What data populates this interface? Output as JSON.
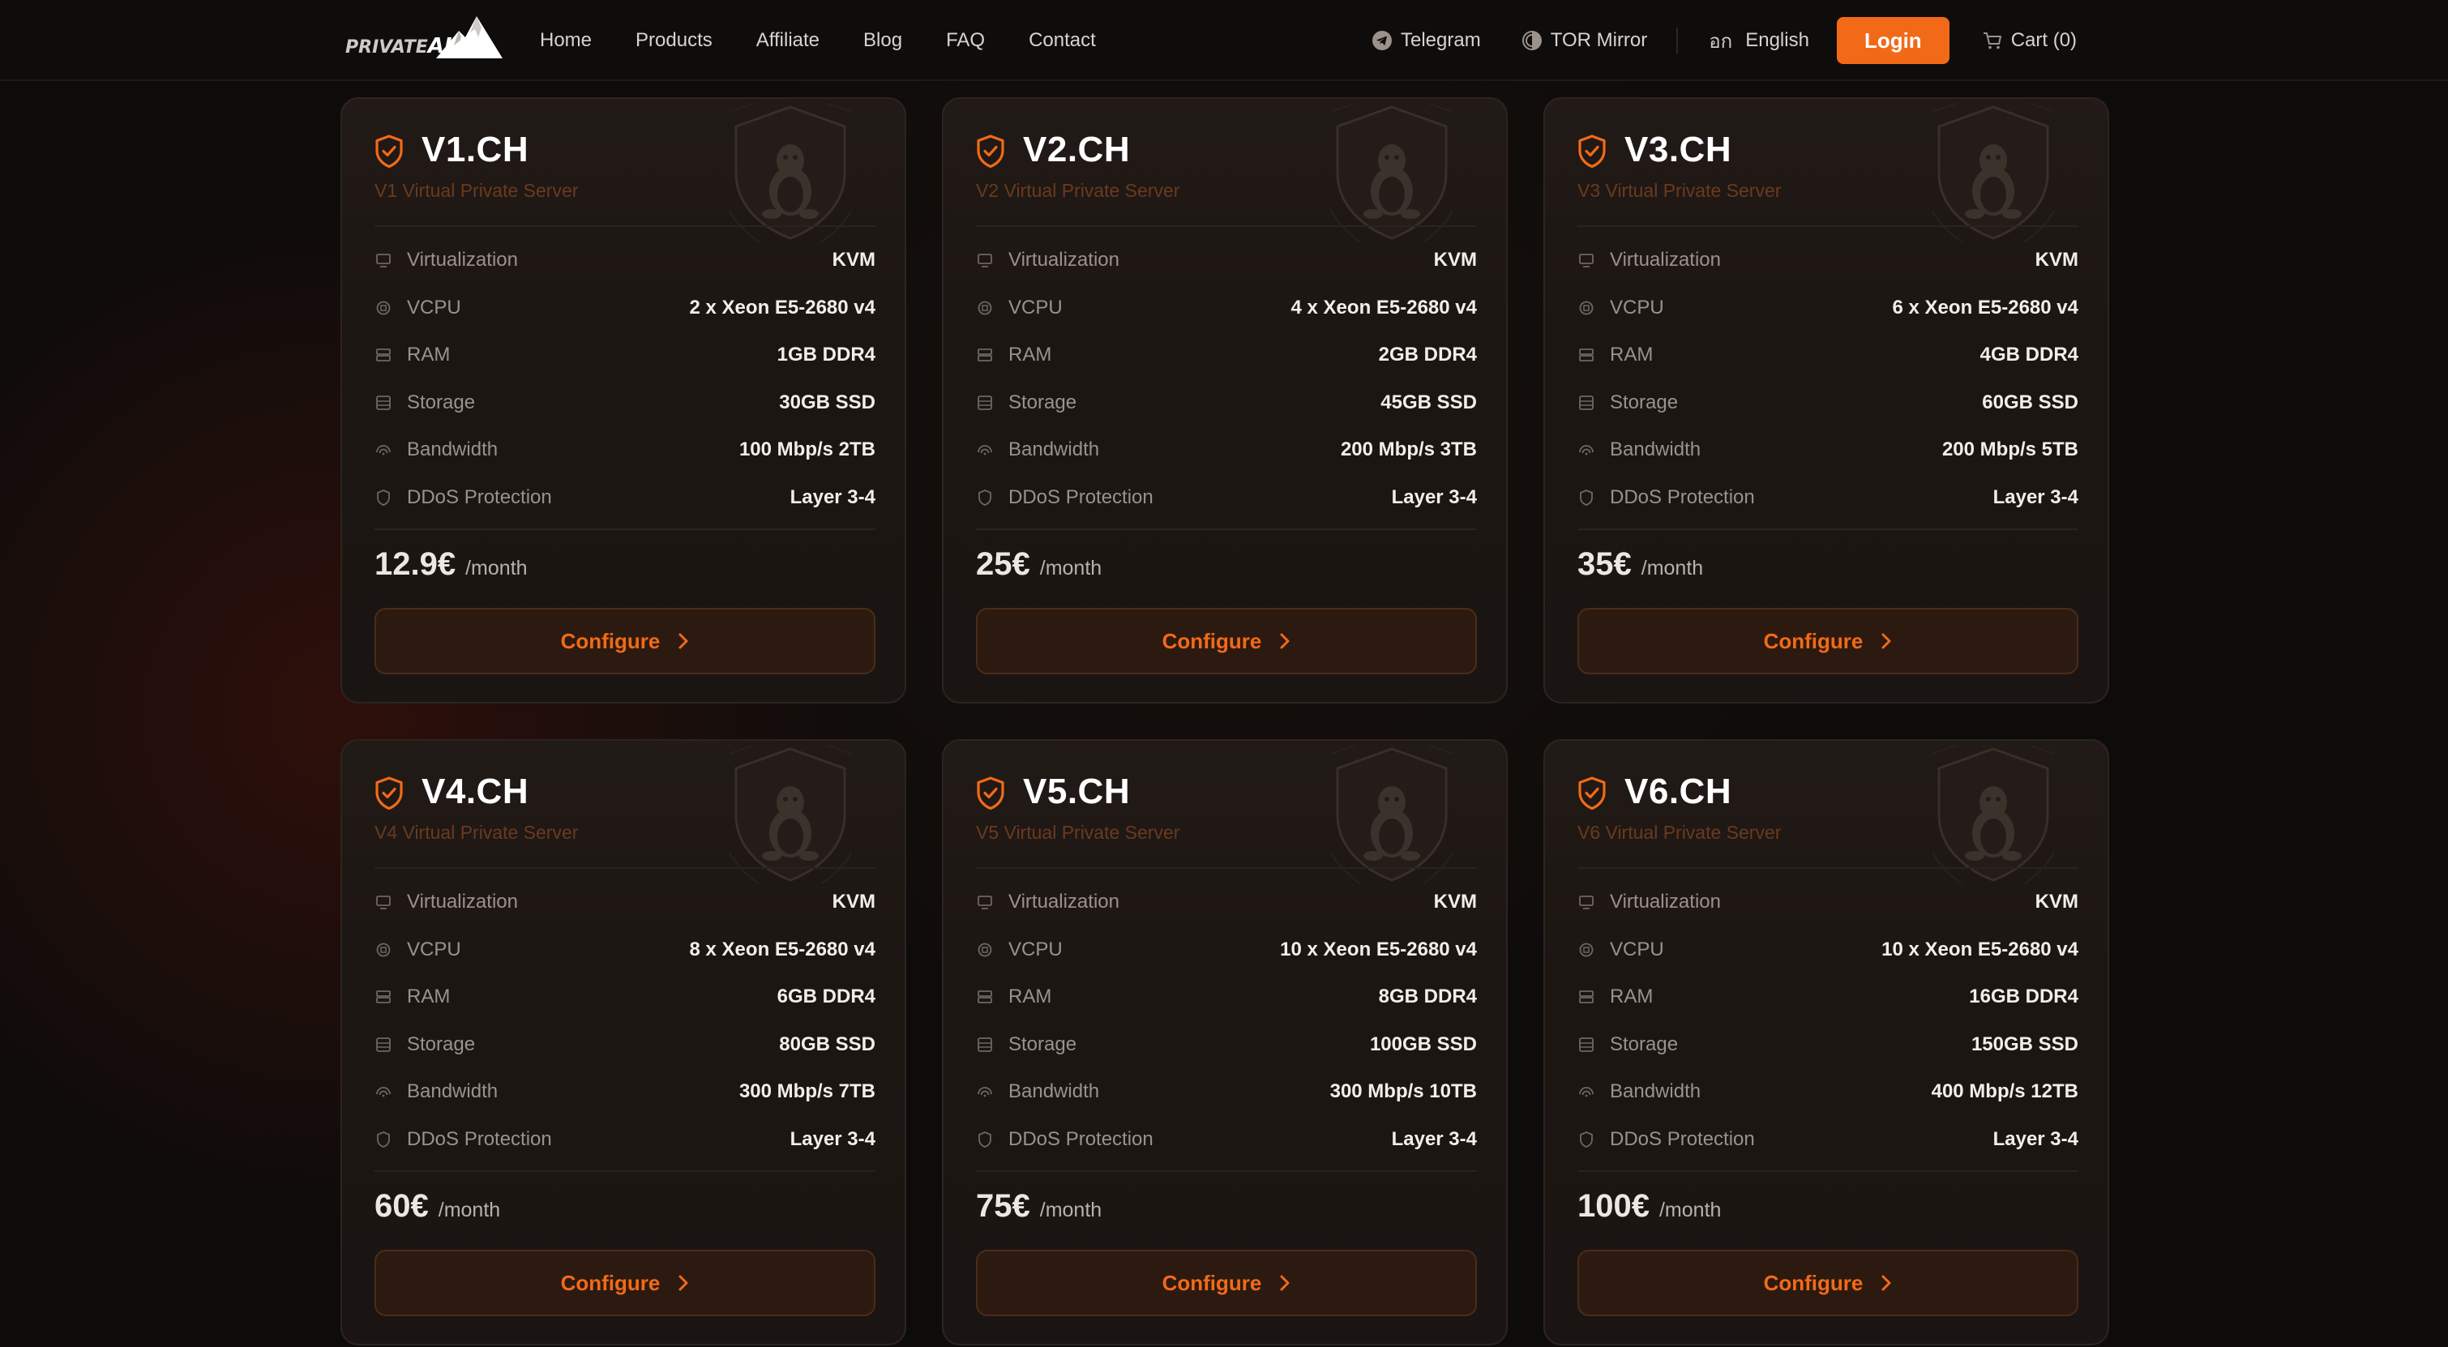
{
  "brand": {
    "logo_left": "PRIVATE",
    "logo_right": "ALPS"
  },
  "nav": {
    "left": [
      {
        "label": "Home"
      },
      {
        "label": "Products"
      },
      {
        "label": "Affiliate"
      },
      {
        "label": "Blog"
      },
      {
        "label": "FAQ"
      },
      {
        "label": "Contact"
      }
    ],
    "telegram": "Telegram",
    "tor": "TOR Mirror",
    "language": "English",
    "language_icon": "อก",
    "login": "Login",
    "cart": "Cart (0)"
  },
  "colors": {
    "accent": "#f26a17",
    "background": "#0e0c0b",
    "card": "#1c1613"
  },
  "spec_labels": {
    "virt": "Virtualization",
    "vcpu": "VCPU",
    "ram": "RAM",
    "storage": "Storage",
    "bandwidth": "Bandwidth",
    "ddos": "DDoS Protection"
  },
  "configure_label": "Configure",
  "period_label": "/month",
  "plans": [
    {
      "title": "V1.CH",
      "subtitle": "V1 Virtual Private Server",
      "virt": "KVM",
      "vcpu": "2 x Xeon E5-2680 v4",
      "ram": "1GB DDR4",
      "storage": "30GB SSD",
      "bandwidth": "100 Mbp/s 2TB",
      "ddos": "Layer 3-4",
      "price": "12.9€"
    },
    {
      "title": "V2.CH",
      "subtitle": "V2 Virtual Private Server",
      "virt": "KVM",
      "vcpu": "4 x Xeon E5-2680 v4",
      "ram": "2GB DDR4",
      "storage": "45GB SSD",
      "bandwidth": "200 Mbp/s 3TB",
      "ddos": "Layer 3-4",
      "price": "25€"
    },
    {
      "title": "V3.CH",
      "subtitle": "V3 Virtual Private Server",
      "virt": "KVM",
      "vcpu": "6 x Xeon E5-2680 v4",
      "ram": "4GB DDR4",
      "storage": "60GB SSD",
      "bandwidth": "200 Mbp/s 5TB",
      "ddos": "Layer 3-4",
      "price": "35€"
    },
    {
      "title": "V4.CH",
      "subtitle": "V4 Virtual Private Server",
      "virt": "KVM",
      "vcpu": "8 x Xeon E5-2680 v4",
      "ram": "6GB DDR4",
      "storage": "80GB SSD",
      "bandwidth": "300 Mbp/s 7TB",
      "ddos": "Layer 3-4",
      "price": "60€"
    },
    {
      "title": "V5.CH",
      "subtitle": "V5 Virtual Private Server",
      "virt": "KVM",
      "vcpu": "10 x Xeon E5-2680 v4",
      "ram": "8GB DDR4",
      "storage": "100GB SSD",
      "bandwidth": "300 Mbp/s 10TB",
      "ddos": "Layer 3-4",
      "price": "75€"
    },
    {
      "title": "V6.CH",
      "subtitle": "V6 Virtual Private Server",
      "virt": "KVM",
      "vcpu": "10 x Xeon E5-2680 v4",
      "ram": "16GB DDR4",
      "storage": "150GB SSD",
      "bandwidth": "400 Mbp/s 12TB",
      "ddos": "Layer 3-4",
      "price": "100€"
    }
  ]
}
